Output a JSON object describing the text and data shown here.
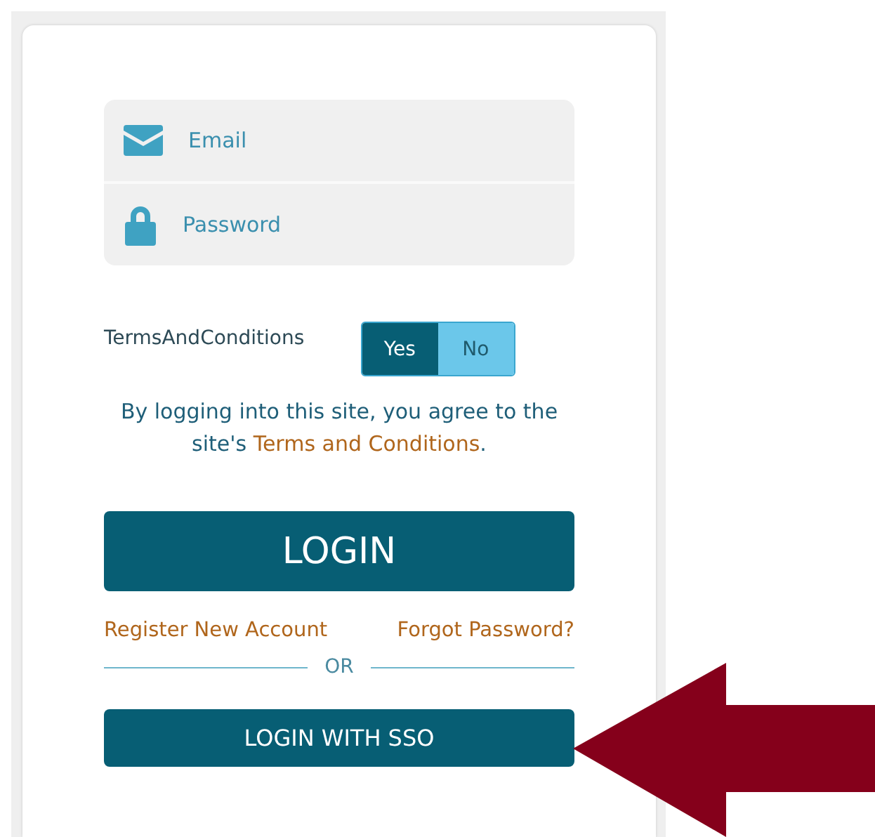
{
  "login_form": {
    "fields": [
      {
        "kind": "email",
        "placeholder": "Email"
      },
      {
        "kind": "password",
        "placeholder": "Password"
      }
    ],
    "terms_toggle": {
      "label": "TermsAndConditions",
      "options": [
        {
          "label": "Yes",
          "selected": true
        },
        {
          "label": "No",
          "selected": false
        }
      ]
    },
    "agreement": {
      "text": "By logging into this site, you agree to the site's",
      "link": "Terms and Conditions",
      "end": "."
    },
    "login_button": "LOGIN",
    "links": [
      "Register New Account",
      "Forgot Password?"
    ],
    "divider": "OR",
    "sso_button": "LOGIN WITH SSO"
  }
}
